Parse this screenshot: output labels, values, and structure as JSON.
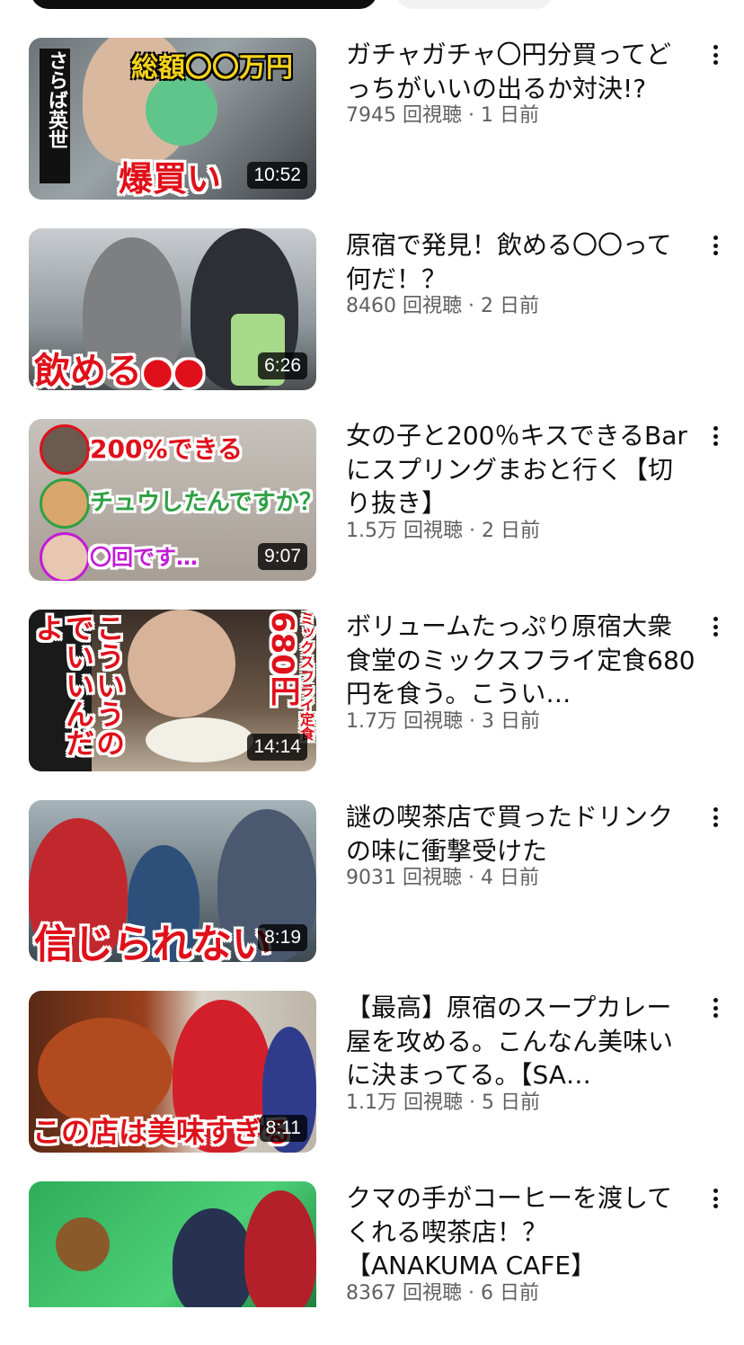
{
  "chips": [
    {
      "label": "",
      "active": true
    },
    {
      "label": "",
      "active": false
    }
  ],
  "videos": [
    {
      "title": "ガチャガチャ〇円分買ってどっちがいいの出るか対決!?",
      "views": "7945 回視聴",
      "age": "1 日前",
      "duration": "10:52",
      "thumb_captions": [
        "総額〇〇万円",
        "爆買い",
        "さらば英世"
      ]
    },
    {
      "title": "原宿で発見！飲める〇〇って何だ！？",
      "views": "8460 回視聴",
      "age": "2 日前",
      "duration": "6:26",
      "thumb_captions": [
        "飲める●●"
      ]
    },
    {
      "title": "女の子と200％キスできるBarにスプリングまおと行く【切り抜き】",
      "views": "1.5万 回視聴",
      "age": "2 日前",
      "duration": "9:07",
      "thumb_captions": [
        "200%できる",
        "チュウしたんですか？",
        "〇回です…"
      ]
    },
    {
      "title": "ボリュームたっぷり原宿大衆食堂のミックスフライ定食680円を食う。こうい…",
      "views": "1.7万 回視聴",
      "age": "3 日前",
      "duration": "14:14",
      "thumb_captions": [
        "こういうのでいいんだよ",
        "680円",
        "ミックスフライ定食"
      ]
    },
    {
      "title": "謎の喫茶店で買ったドリンクの味に衝撃受けた",
      "views": "9031 回視聴",
      "age": "4 日前",
      "duration": "8:19",
      "thumb_captions": [
        "信じられない"
      ]
    },
    {
      "title": "【最高】原宿のスープカレー屋を攻める。こんなん美味いに決まってる。【SA…",
      "views": "1.1万 回視聴",
      "age": "5 日前",
      "duration": "8:11",
      "thumb_captions": [
        "この店は美味すぎる"
      ]
    },
    {
      "title": "クマの手がコーヒーを渡してくれる喫茶店！？【ANAKUMA CAFE】",
      "views": "8367 回視聴",
      "age": "6 日前",
      "duration": "",
      "thumb_captions": []
    }
  ],
  "colors": {
    "title_text": "#0f0f0f",
    "meta_text": "#606060",
    "caption_red": "#e0101a",
    "caption_yellow": "#f5d21c",
    "chip_active": "#0f0f0f",
    "chip_inactive": "#f2f2f2"
  },
  "icons": {
    "more": "more-vert-icon"
  }
}
